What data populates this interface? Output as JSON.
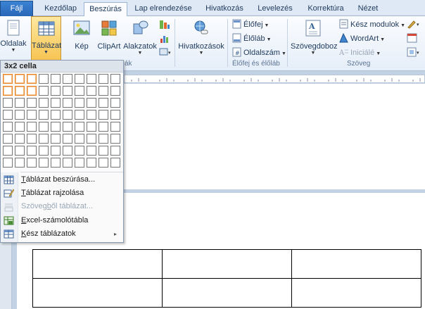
{
  "tabs": [
    {
      "label": "Fájl"
    },
    {
      "label": "Kezdőlap"
    },
    {
      "label": "Beszúrás"
    },
    {
      "label": "Lap elrendezése"
    },
    {
      "label": "Hivatkozás"
    },
    {
      "label": "Levelezés"
    },
    {
      "label": "Korrektúra"
    },
    {
      "label": "Nézet"
    }
  ],
  "ribbon": {
    "oldalak": "Oldalak",
    "tablazat": "Táblázat",
    "kep": "Kép",
    "clipart": "ClipArt",
    "alakzatok": "Alakzatok",
    "hivatkozasok": "Hivatkozások",
    "elofej": "Élőfej",
    "elolab": "Élőláb",
    "oldalszam": "Oldalszám",
    "szovegdoboz": "Szövegdoboz",
    "kesz_modulok": "Kész modulok",
    "wordart": "WordArt",
    "iniciale": "Iniciálé",
    "group_abrak": "ák",
    "group_elofej": "Élőfej és élőláb",
    "group_szoveg": "Szöveg"
  },
  "menu": {
    "header": "3x2 cella",
    "grid": {
      "cols": 10,
      "rows": 8,
      "selected_cols": 3,
      "selected_rows": 2
    },
    "items": [
      {
        "pre": "",
        "u": "T",
        "post": "áblázat beszúrása...",
        "disabled": false,
        "has_submenu": false
      },
      {
        "pre": "",
        "u": "T",
        "post": "áblázat rajzolása",
        "disabled": false,
        "has_submenu": false
      },
      {
        "pre": "Szöveg",
        "u": "b",
        "post": "ől táblázat...",
        "disabled": true,
        "has_submenu": false
      },
      {
        "pre": "",
        "u": "E",
        "post": "xcel-számolótábla",
        "disabled": false,
        "has_submenu": false
      },
      {
        "pre": "",
        "u": "K",
        "post": "ész táblázatok",
        "disabled": false,
        "has_submenu": true
      }
    ],
    "submenu_arrow": "▸"
  },
  "document": {
    "table": {
      "rows": 2,
      "cols": 3
    }
  }
}
